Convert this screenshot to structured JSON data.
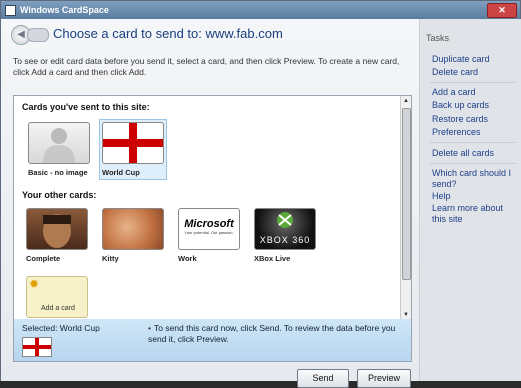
{
  "window": {
    "title": "Windows CardSpace",
    "close_label": "✕"
  },
  "header": {
    "title": "Choose a card to send to: www.fab.com"
  },
  "instructions": "To see or edit card data before you send it, select a card, and then click Preview. To create a new card, click Add a card and then click Add.",
  "sent_section": {
    "label": "Cards you've sent to this site:",
    "cards": [
      {
        "label": "Basic - no image",
        "icon": "person-silhouette-icon"
      },
      {
        "label": "World Cup",
        "icon": "england-flag-icon"
      }
    ]
  },
  "other_section": {
    "label": "Your other cards:",
    "cards": [
      {
        "label": "Complete",
        "icon": "photo-man-icon"
      },
      {
        "label": "Kitty",
        "icon": "photo-kitty-icon"
      },
      {
        "label": "Work",
        "icon": "microsoft-logo-icon",
        "logo_text": "Microsoft",
        "logo_sub": "Your potential. Our passion."
      },
      {
        "label": "XBox Live",
        "icon": "xbox-logo-icon",
        "logo_text": "XBOX 360"
      }
    ],
    "add_card": {
      "label": "Add a card",
      "icon": "sun-icon"
    }
  },
  "selection": {
    "selected_text": "Selected: World Cup",
    "hint": "To send this card now, click Send.  To review the data before you send it, click Preview."
  },
  "buttons": {
    "send": "Send",
    "preview": "Preview"
  },
  "tasks": {
    "heading": "Tasks",
    "group1": [
      "Duplicate card",
      "Delete card"
    ],
    "group2": [
      "Add a card",
      "Back up cards",
      "Restore cards",
      "Preferences"
    ],
    "group3": [
      "Delete all cards"
    ],
    "group4": [
      "Which card should I send?",
      "Help",
      "Learn more about this site"
    ]
  },
  "colors": {
    "link": "#1f3f8a",
    "title": "#1a3f80",
    "flag_red": "#cc0000"
  }
}
